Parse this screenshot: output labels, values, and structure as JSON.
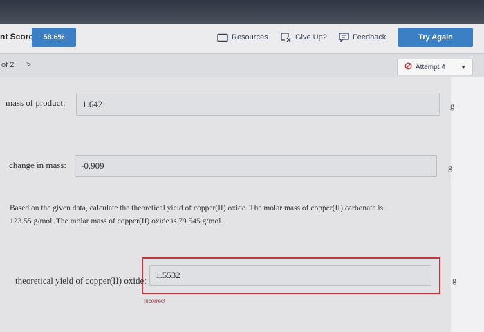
{
  "header": {
    "score_label": "nt Score:",
    "score_value": "58.6%",
    "resources_label": "Resources",
    "giveup_label": "Give Up?",
    "feedback_label": "Feedback",
    "try_again_label": "Try Again"
  },
  "nav": {
    "page_label": "of 2",
    "next_icon": "chevron-right-icon",
    "attempt_label": "Attempt 4"
  },
  "fields": {
    "mass_product": {
      "label": "mass of product:",
      "value": "1.642",
      "unit": "g"
    },
    "change_mass": {
      "label": "change in mass:",
      "value": "-0.909",
      "unit": "g"
    },
    "theoretical_yield": {
      "label": "theoretical yield of copper(II) oxide:",
      "value": "1.5532",
      "unit": "g",
      "status": "Incorrect"
    }
  },
  "question": {
    "line1": "Based on the given data, calculate the theoretical yield of copper(II) oxide. The molar mass of copper(II) carbonate is",
    "line2": "123.55 g/mol. The molar mass of copper(II) oxide is 79.545 g/mol."
  },
  "colors": {
    "accent": "#3b7fc4",
    "error": "#c9343b",
    "topbar": "#2f3744"
  }
}
